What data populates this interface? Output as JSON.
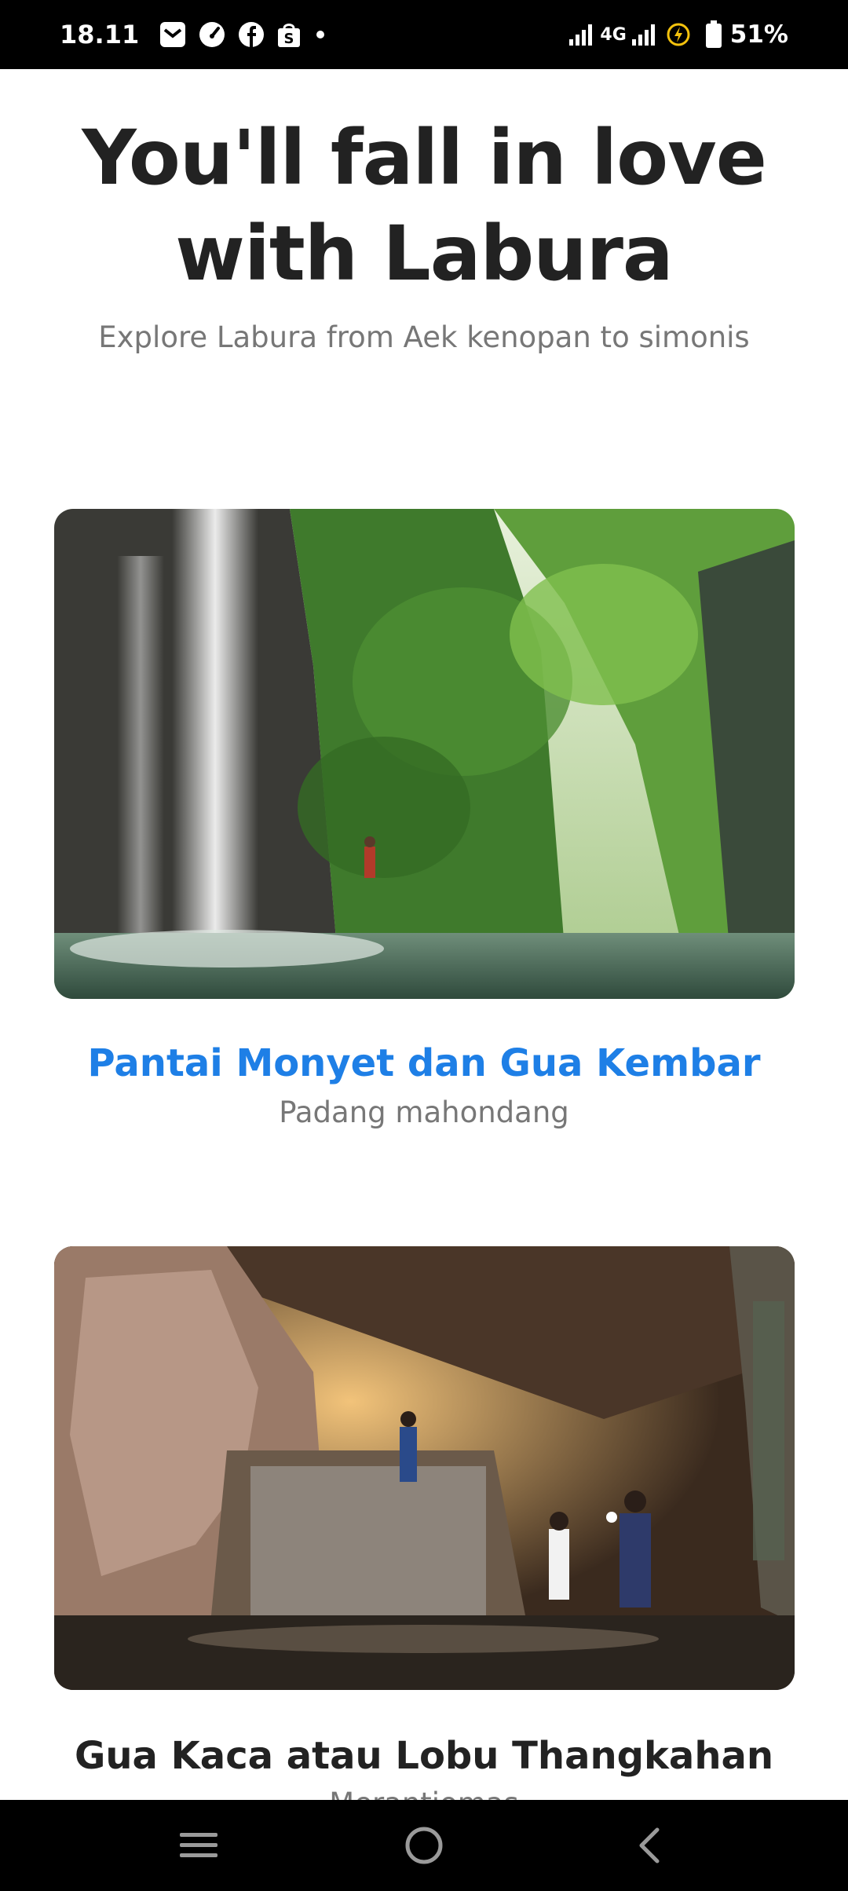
{
  "status_bar": {
    "time": "18.11",
    "network": "4G",
    "battery": "51%",
    "icons": [
      "gmail-icon",
      "speed-icon",
      "facebook-icon",
      "shopee-icon",
      "more-notifications-dot",
      "signal-icon",
      "signal-icon",
      "charging-icon",
      "battery-icon"
    ]
  },
  "hero": {
    "title": "You'll fall in love with Labura",
    "subtitle": "Explore Labura from Aek kenopan to simonis"
  },
  "places": [
    {
      "title": "Pantai Monyet dan Gua Kembar",
      "subtitle": "Padang mahondang",
      "title_color": "#1e7fe6"
    },
    {
      "title": "Gua Kaca atau Lobu Thangkahan",
      "subtitle": "Merantiomas",
      "title_color": "#222222"
    }
  ],
  "nav_bar": {
    "icons": [
      "recent-apps-icon",
      "home-icon",
      "back-icon"
    ]
  }
}
